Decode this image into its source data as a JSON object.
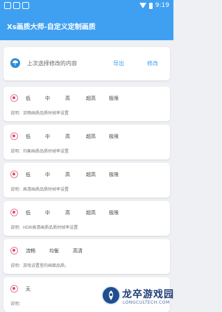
{
  "status_bar": {
    "time": "9:19"
  },
  "app_bar": {
    "title": "Xs画质大师-自定义定制画质"
  },
  "top_card": {
    "label": "上次选择修改的内容",
    "export_label": "导出",
    "modify_label": "修改"
  },
  "quality_cards": [
    {
      "options": [
        "低",
        "中",
        "高",
        "超高",
        "极限"
      ],
      "description": "说明：流畅画质品质时帧率设置"
    },
    {
      "options": [
        "低",
        "中",
        "高",
        "超高",
        "极限"
      ],
      "description": "说明：均衡画质品质时帧率设置"
    },
    {
      "options": [
        "低",
        "中",
        "高",
        "超高",
        "极限"
      ],
      "description": "说明：高清画质品质时帧率设置"
    },
    {
      "options": [
        "低",
        "中",
        "高",
        "超高",
        "极限"
      ],
      "description": "说明：HDR高清画质品质时帧率设置"
    },
    {
      "options": [
        "流畅",
        "均衡",
        "高清"
      ],
      "description": "说明：游戏设置里的画面品质。"
    },
    {
      "options": [
        "无"
      ],
      "description": "说明："
    }
  ],
  "watermark": {
    "text": "龙卒游戏园",
    "sub": "LONGCULTECH.COM"
  }
}
